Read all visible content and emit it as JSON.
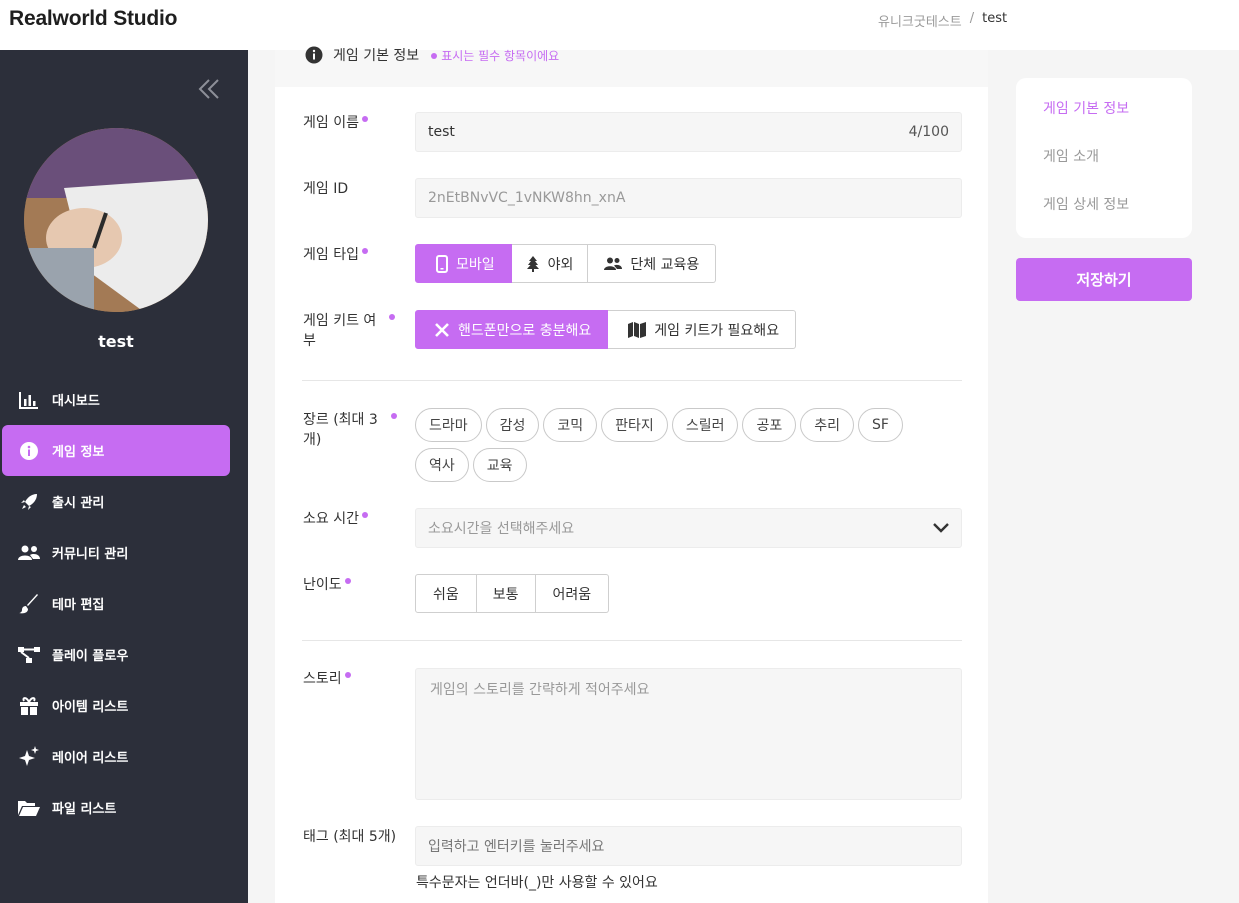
{
  "app": {
    "logo": "Realworld Studio"
  },
  "breadcrumb": {
    "parent": "유니크굿테스트",
    "separator": "/",
    "current": "test"
  },
  "sidebar": {
    "username": "test",
    "items": [
      {
        "label": "대시보드",
        "icon": "chart-bar-icon"
      },
      {
        "label": "게임 정보",
        "icon": "info-circle-icon",
        "active": true
      },
      {
        "label": "출시 관리",
        "icon": "rocket-icon"
      },
      {
        "label": "커뮤니티 관리",
        "icon": "users-icon"
      },
      {
        "label": "테마 편집",
        "icon": "paintbrush-icon"
      },
      {
        "label": "플레이 플로우",
        "icon": "flow-icon"
      },
      {
        "label": "아이템 리스트",
        "icon": "gift-icon"
      },
      {
        "label": "레이어 리스트",
        "icon": "sparkles-icon"
      },
      {
        "label": "파일 리스트",
        "icon": "folder-open-icon"
      }
    ]
  },
  "form": {
    "section_title": "게임 기본 정보",
    "required_note": "표시는 필수 항목이에요",
    "name": {
      "label": "게임 이름",
      "value": "test",
      "counter": "4/100"
    },
    "id": {
      "label": "게임 ID",
      "value": "2nEtBNvVC_1vNKW8hn_xnA"
    },
    "type": {
      "label": "게임 타입",
      "options": [
        "모바일",
        "야외",
        "단체 교육용"
      ],
      "selected": "모바일"
    },
    "kit": {
      "label_line1": "게임 키트 여",
      "label_line2": "부",
      "options": [
        "핸드폰만으로 충분해요",
        "게임 키트가 필요해요"
      ],
      "selected": "핸드폰만으로 충분해요"
    },
    "genre": {
      "label_line1": "장르 (최대 3",
      "label_line2": "개)",
      "options": [
        "드라마",
        "감성",
        "코믹",
        "판타지",
        "스릴러",
        "공포",
        "추리",
        "SF",
        "역사",
        "교육"
      ]
    },
    "duration": {
      "label": "소요 시간",
      "placeholder": "소요시간을 선택해주세요"
    },
    "difficulty": {
      "label": "난이도",
      "options": [
        "쉬움",
        "보통",
        "어려움"
      ]
    },
    "story": {
      "label": "스토리",
      "placeholder": "게임의 스토리를 간략하게 적어주세요"
    },
    "tags": {
      "label": "태그 (최대 5개)",
      "placeholder": "입력하고 엔터키를 눌러주세요",
      "hint": "특수문자는 언더바(_)만 사용할 수 있어요"
    }
  },
  "toc": {
    "items": [
      "게임 기본 정보",
      "게임 소개",
      "게임 상세 정보"
    ],
    "active": "게임 기본 정보"
  },
  "save_label": "저장하기",
  "colors": {
    "accent": "#c66cf2",
    "sidebar_bg": "#2c2f3a"
  }
}
